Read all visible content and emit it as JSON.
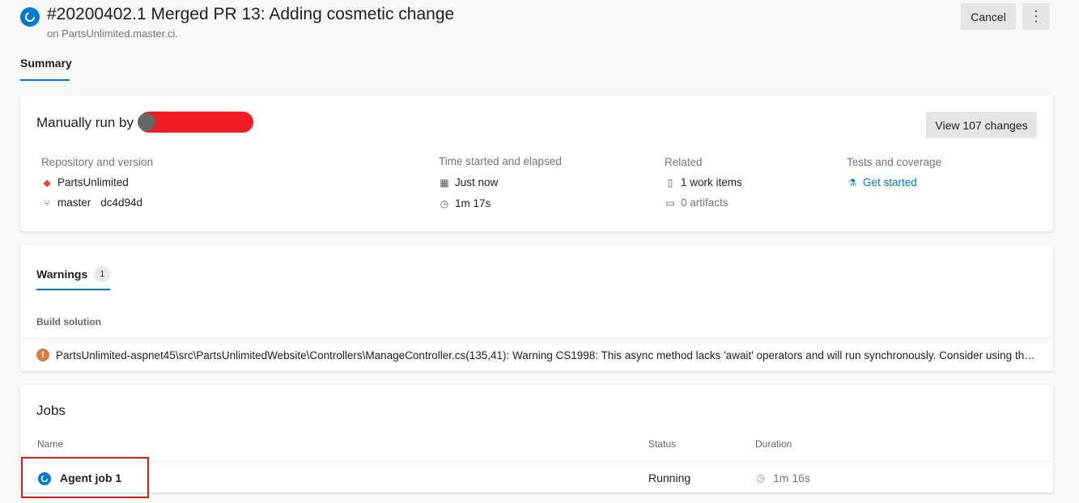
{
  "header": {
    "title": "#20200402.1 Merged PR 13: Adding cosmetic change",
    "subtitle": "on PartsUnlimited.master.ci.",
    "cancel_label": "Cancel",
    "more_label": "⋮",
    "status_icon": "running-icon"
  },
  "tabs": [
    {
      "label": "Summary",
      "active": true
    }
  ],
  "summary": {
    "manual_run": "Manually run by",
    "view_changes": "View 107 changes",
    "repo": {
      "label": "Repository and version",
      "name": "PartsUnlimited",
      "branch": "master",
      "commit": "dc4d94d"
    },
    "time": {
      "label": "Time started and elapsed",
      "started": "Just now",
      "elapsed": "1m 17s"
    },
    "related": {
      "label": "Related",
      "work_items": "1 work items",
      "artifacts": "0 artifacts"
    },
    "tests": {
      "label": "Tests and coverage",
      "link": "Get started"
    }
  },
  "warnings": {
    "tab_label": "Warnings",
    "count": "1",
    "section": "Build solution",
    "message": "PartsUnlimited-aspnet45\\src\\PartsUnlimitedWebsite\\Controllers\\ManageController.cs(135,41): Warning CS1998: This async method lacks 'await' operators and will run synchronously. Consider using the 'await' operator"
  },
  "jobs": {
    "title": "Jobs",
    "columns": {
      "name": "Name",
      "status": "Status",
      "duration": "Duration"
    },
    "rows": [
      {
        "name": "Agent job 1",
        "status": "Running",
        "duration": "1m 16s"
      }
    ]
  },
  "colors": {
    "accent": "#0078d4",
    "warning": "#d67f3c",
    "highlight": "#d91e18",
    "redaction": "#ee1c24"
  }
}
